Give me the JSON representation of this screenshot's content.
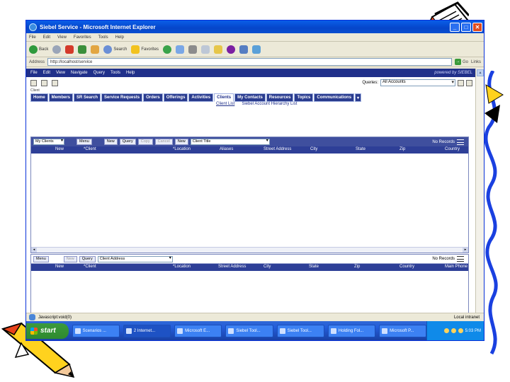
{
  "window": {
    "title": "Siebel Service - Microsoft Internet Explorer",
    "controls": [
      "_",
      "□",
      "✕"
    ]
  },
  "ie_menu": [
    "File",
    "Edit",
    "View",
    "Favorites",
    "Tools",
    "Help"
  ],
  "ie_toolbar": {
    "back": "Back",
    "search": "Search",
    "favorites": "Favorites"
  },
  "address": {
    "label": "Address",
    "value": "http://localhost/service",
    "go": "Go",
    "links": "Links"
  },
  "siebel_menu": {
    "items": [
      "File",
      "Edit",
      "View",
      "Navigate",
      "Query",
      "Tools",
      "Help"
    ],
    "logo": "powered by SIEBEL"
  },
  "queries": {
    "label": "Queries:",
    "value": "All Accounts"
  },
  "breadcrumb": "Client",
  "tabs": [
    "Home",
    "Members",
    "SR Search",
    "Service Requests",
    "Orders",
    "Offerings",
    "Activities",
    "Clients",
    "My Contacts",
    "Resources",
    "Topics",
    "Communications"
  ],
  "active_tab": "Clients",
  "subtabs": [
    "Client List",
    "Siebel Account Hierarchy List"
  ],
  "list_applet": {
    "visibility": "My Clients",
    "menu": "Menu",
    "buttons": [
      "New",
      "Query",
      "Copy",
      "Cancel"
    ],
    "disabled_buttons": [
      "Copy",
      "Cancel"
    ],
    "new_button": "New",
    "dropdown": "Client Title",
    "status": "No Records",
    "columns": [
      "New",
      "*Client",
      "*Location",
      "Aliases",
      "Street Address",
      "City",
      "State",
      "Zip",
      "Country"
    ]
  },
  "detail_applet": {
    "menu": "Menu",
    "new": "New",
    "query": "Query",
    "dropdown": "Client Address",
    "status": "No Records",
    "columns": [
      "New",
      "*Client",
      "*Location",
      "Street Address",
      "City",
      "State",
      "Zip",
      "Country",
      "Main Phone"
    ]
  },
  "statusbar": {
    "text": "Javascript:void(0)",
    "zone": "Local intranet"
  },
  "taskbar": {
    "start": "start",
    "tasks": [
      "Scenarios ...",
      "2 Internet...",
      "Microsoft E...",
      "Siebel Tool...",
      "Siebel Tool...",
      "Holding Fol...",
      "Microsoft P..."
    ],
    "clock": "5:03 PM"
  },
  "colors": {
    "siebel_navy": "#20308a",
    "xp_blue": "#0a5ee8",
    "start_green": "#3c9a3c"
  }
}
